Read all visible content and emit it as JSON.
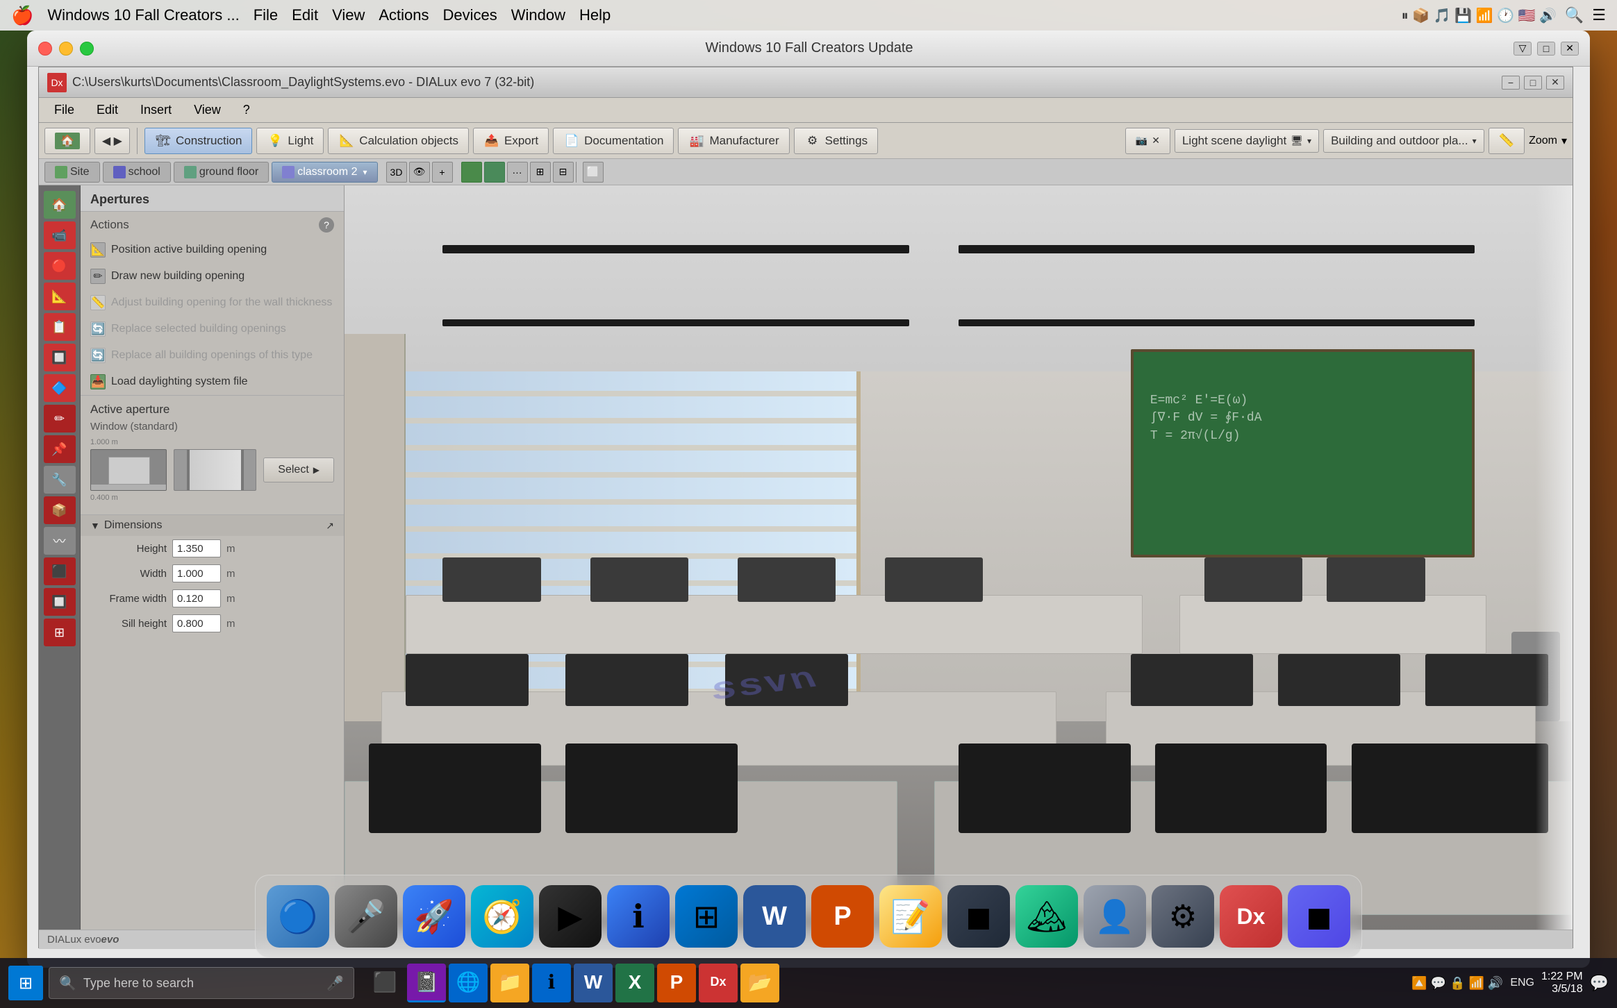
{
  "mac": {
    "menubar_title": "Windows 10 Fall Creators ...",
    "menu_items": [
      "Apple",
      "File",
      "Edit",
      "View",
      "Actions",
      "Devices",
      "Window",
      "Help"
    ],
    "window_title": "Windows 10 Fall Creators Update"
  },
  "app": {
    "title": "C:\\Users\\kurts\\Documents\\Classroom_DaylightSystems.evo - DIALux evo 7  (32-bit)",
    "menu_items": [
      "File",
      "Edit",
      "Insert",
      "View",
      "?"
    ],
    "toolbar": {
      "nav_icon_label": "◀▶",
      "construction_label": "Construction",
      "light_label": "Light",
      "calculation_objects_label": "Calculation objects",
      "export_label": "Export",
      "documentation_label": "Documentation",
      "manufacturer_label": "Manufacturer",
      "settings_label": "Settings",
      "light_scene_label": "Light scene daylight",
      "building_outdoor_label": "Building and outdoor pla...",
      "zoom_label": "Zoom"
    },
    "nav": {
      "site_label": "Site",
      "school_label": "school",
      "ground_floor_label": "ground floor",
      "classroom_label": "classroom 2"
    },
    "panel": {
      "title": "Apertures",
      "actions_label": "Actions",
      "actions": [
        {
          "label": "Position active building opening",
          "enabled": true
        },
        {
          "label": "Draw new building opening",
          "enabled": true
        },
        {
          "label": "Adjust building opening for the wall thickness",
          "enabled": false
        },
        {
          "label": "Replace selected building openings",
          "enabled": false
        },
        {
          "label": "Replace all building openings of this type",
          "enabled": false
        },
        {
          "label": "Load daylighting system file",
          "enabled": true
        }
      ],
      "active_aperture_label": "Active aperture",
      "window_type_label": "Window (standard)",
      "select_label": "Select",
      "dimensions_label": "Dimensions",
      "height_label": "Height",
      "height_value": "1.350",
      "width_label": "Width",
      "width_value": "1.000",
      "frame_width_label": "Frame width",
      "frame_width_value": "0.120",
      "sill_height_label": "Sill height",
      "sill_height_value": "0.800",
      "unit": "m"
    },
    "statusbar": {
      "text": "DIALux evo"
    }
  },
  "taskbar": {
    "search_placeholder": "Type here to search",
    "time": "1:22 PM",
    "date": "3/5/18",
    "language": "ENG",
    "apps": [
      {
        "name": "Task View",
        "icon": "⬛"
      },
      {
        "name": "OneNote",
        "icon": "📓"
      },
      {
        "name": "Internet Explorer",
        "icon": "ℹ"
      },
      {
        "name": "Documents",
        "icon": "📁"
      },
      {
        "name": "IE",
        "icon": "🌐"
      },
      {
        "name": "Word",
        "icon": "W"
      },
      {
        "name": "Excel",
        "icon": "X"
      },
      {
        "name": "PowerPoint",
        "icon": "P"
      },
      {
        "name": "DIALux",
        "icon": "Dx"
      },
      {
        "name": "File Explorer",
        "icon": "📂"
      }
    ]
  },
  "dock": {
    "items": [
      {
        "name": "Finder",
        "label": "🔵"
      },
      {
        "name": "Siri",
        "label": "🎤"
      },
      {
        "name": "Launchpad",
        "label": "🚀"
      },
      {
        "name": "Safari",
        "label": "🧭"
      },
      {
        "name": "QuickTime",
        "label": "▶"
      },
      {
        "name": "IE",
        "label": "ℹ"
      },
      {
        "name": "Windows",
        "label": "⊞"
      },
      {
        "name": "Word",
        "label": "W"
      },
      {
        "name": "PowerPoint",
        "label": "P"
      },
      {
        "name": "Notes",
        "label": "📝"
      },
      {
        "name": "App1",
        "label": "◼"
      },
      {
        "name": "Photos",
        "label": "🏔"
      },
      {
        "name": "Person",
        "label": "👤"
      },
      {
        "name": "SystemPrefs",
        "label": "⚙"
      },
      {
        "name": "DIALux",
        "label": "Dx"
      },
      {
        "name": "Finder2",
        "label": "◼"
      }
    ]
  },
  "scene": {
    "watermark_text": "ssvn"
  }
}
